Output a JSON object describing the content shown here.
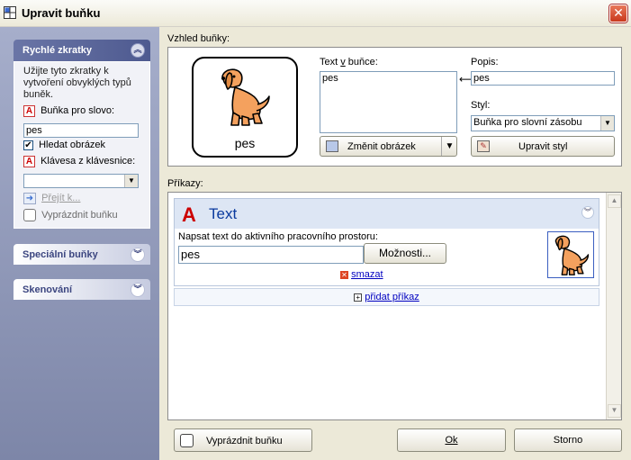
{
  "window": {
    "title": "Upravit buňku",
    "close_icon": "close-icon"
  },
  "taskpane": {
    "sections": [
      {
        "label": "Rychlé zkratky",
        "expanded": true
      },
      {
        "label": "Speciální buňky",
        "expanded": false
      },
      {
        "label": "Skenování",
        "expanded": false
      }
    ],
    "intro": "Užijte tyto zkratky k vytvoření obvyklých typů buněk.",
    "word_cell_label": "Buňka pro slovo:",
    "word_cell_value": "pes",
    "find_picture_label": "Hledat obrázek",
    "find_picture_checked": true,
    "key_label": "Klávesa z klávesnice:",
    "key_value": "",
    "goto_label": "Přejít k...",
    "clear_label": "Vyprázdnit buňku"
  },
  "appearance": {
    "group_label": "Vzhled buňky:",
    "preview_caption": "pes",
    "text_label": "Text v buňce:",
    "text_value": "pes",
    "change_image_label": "Změnit obrázek",
    "description_label": "Popis:",
    "description_value": "pes",
    "style_label": "Styl:",
    "style_value": "Buňka pro slovní zásobu",
    "edit_style_label": "Upravit styl"
  },
  "commands": {
    "group_label": "Příkazy:",
    "items": [
      {
        "title": "Text",
        "description": "Napsat text do aktivního pracovního prostoru:",
        "value": "pes",
        "options_label": "Možnosti...",
        "delete_label": "smazat"
      }
    ],
    "add_label": "přidat příkaz"
  },
  "footer": {
    "clear_label": "Vyprázdnit buňku",
    "ok_label": "Ok",
    "cancel_label": "Storno"
  },
  "colors": {
    "accent": "#0a3a9e",
    "pane_top": "#a6aecb",
    "pane_bottom": "#7d86a8"
  }
}
